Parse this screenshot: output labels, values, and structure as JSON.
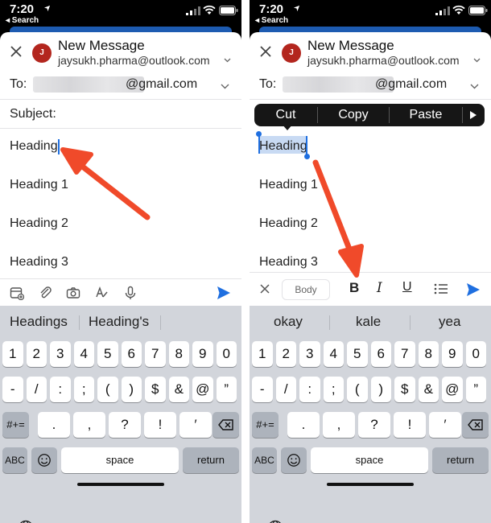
{
  "status": {
    "time": "7:20",
    "back_label": "◂ Search"
  },
  "header": {
    "title": "New Message",
    "from": "jaysukh.pharma@outlook.com",
    "avatar_letter": "J",
    "avatar_color": "#b3261e"
  },
  "recipient": {
    "label": "To:",
    "value": "@gmail.com"
  },
  "subject": {
    "label": "Subject:"
  },
  "body": {
    "lines": [
      "Heading",
      "Heading 1",
      "Heading 2",
      "Heading 3"
    ]
  },
  "edit_menu": {
    "cut": "Cut",
    "copy": "Copy",
    "paste": "Paste"
  },
  "format_bar": {
    "style": "Body",
    "bold": "B",
    "italic": "I",
    "underline": "U"
  },
  "suggestions_left": [
    "Headings",
    "Heading's"
  ],
  "suggestions_right": [
    "okay",
    "kale",
    "yea"
  ],
  "keyboard": {
    "row1": [
      "1",
      "2",
      "3",
      "4",
      "5",
      "6",
      "7",
      "8",
      "9",
      "0"
    ],
    "row2": [
      "-",
      "/",
      ":",
      ";",
      "(",
      ")",
      "$",
      "&",
      "@",
      "”"
    ],
    "row3": [
      ".",
      ",",
      "?",
      "!",
      "′"
    ],
    "symbols_key": "#+=",
    "abc_key": "ABC",
    "space_key": "space",
    "return_key": "return"
  },
  "colors": {
    "accent": "#1f6fe0",
    "annotation_arrow": "#f04a2a",
    "brand_bar": "#1d5bb1"
  }
}
